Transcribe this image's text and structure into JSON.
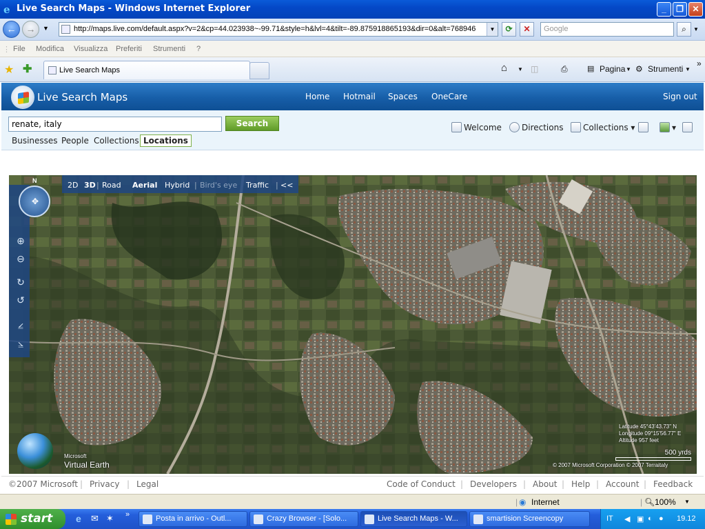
{
  "window": {
    "title": "Live Search Maps - Windows Internet Explorer"
  },
  "address": {
    "url": "http://maps.live.com/default.aspx?v=2&cp=44.023938~-99.71&style=h&lvl=4&tilt=-89.875918865193&dir=0&alt=768946",
    "search_placeholder": "Google"
  },
  "menu": [
    "File",
    "Modifica",
    "Visualizza",
    "Preferiti",
    "Strumenti",
    "?"
  ],
  "tab": {
    "label": "Live Search Maps"
  },
  "ie_tools": {
    "pagina": "Pagina",
    "strumenti": "Strumenti"
  },
  "site": {
    "name": "Live Search Maps",
    "nav": [
      "Home",
      "Hotmail",
      "Spaces",
      "OneCare"
    ],
    "sign_out": "Sign out"
  },
  "search": {
    "query": "renate, italy",
    "button": "Search",
    "categories": [
      "Businesses",
      "People",
      "Collections",
      "Locations"
    ],
    "active_category": "Locations"
  },
  "right_tools": {
    "welcome": "Welcome",
    "directions": "Directions",
    "collections": "Collections"
  },
  "map": {
    "north": "N",
    "modes": [
      "2D",
      "3D",
      "Road",
      "Aerial",
      "Hybrid",
      "Bird's eye",
      "Traffic",
      "<<"
    ],
    "active_dimension": "3D",
    "active_style": "Aerial",
    "latitude": "Latitude 45°43'43.73\" N",
    "longitude": "Longitude 09°15'56.77\" E",
    "altitude": "Altitude 957 feet",
    "scale": "500 yrds",
    "copyright": "© 2007 Microsoft Corporation  © 2007 Terraitaly",
    "ve_brand": "Virtual Earth",
    "ve_small": "Microsoft"
  },
  "footer": {
    "left": [
      "©2007 Microsoft",
      "Privacy",
      "Legal"
    ],
    "right": [
      "Code of Conduct",
      "Developers",
      "About",
      "Help",
      "Account",
      "Feedback"
    ]
  },
  "status": {
    "zone": "Internet",
    "zoom": "100%"
  },
  "taskbar": {
    "start": "start",
    "tasks": [
      "Posta in arrivo - Outl...",
      "Crazy Browser - [Solo...",
      "Live Search Maps - W...",
      "smartision Screencopy"
    ],
    "lang": "IT",
    "clock": "19.12"
  }
}
